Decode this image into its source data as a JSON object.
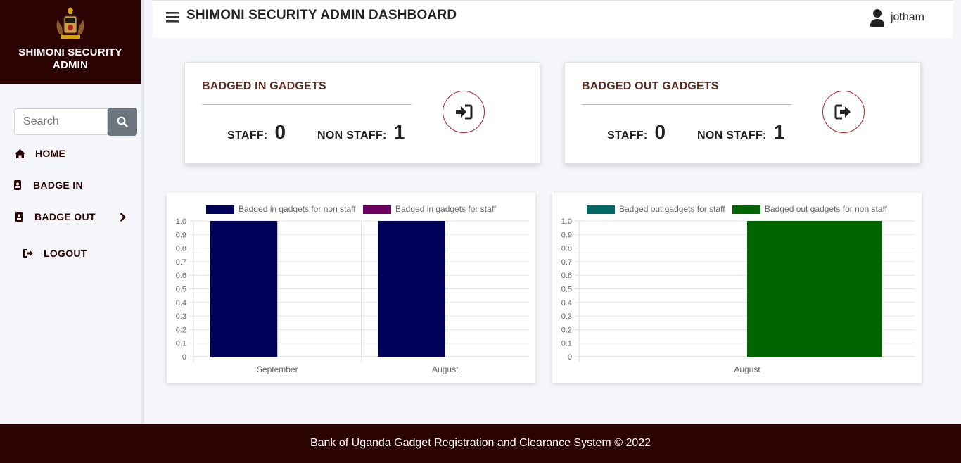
{
  "sidebar": {
    "brand_line1": "SHIMONI SECURITY",
    "brand_line2": "ADMIN",
    "search_placeholder": "Search",
    "items": [
      {
        "label": "HOME",
        "icon": "home-icon"
      },
      {
        "label": "BADGE IN",
        "icon": "id-badge-icon"
      },
      {
        "label": "BADGE OUT",
        "icon": "id-badge-icon"
      },
      {
        "label": "LOGOUT",
        "icon": "sign-out-icon"
      }
    ]
  },
  "header": {
    "title": "SHIMONI SECURITY ADMIN DASHBOARD",
    "username": "jotham"
  },
  "cards": [
    {
      "title": "BADGED IN GADGETS",
      "staff_label": "STAFF:",
      "staff_value": "0",
      "nonstaff_label": "NON STAFF:",
      "nonstaff_value": "1",
      "icon": "sign-in-icon"
    },
    {
      "title": "BADGED OUT GADGETS",
      "staff_label": "STAFF:",
      "staff_value": "0",
      "nonstaff_label": "NON STAFF:",
      "nonstaff_value": "1",
      "icon": "sign-out-icon"
    }
  ],
  "chart_data": [
    {
      "type": "bar",
      "categories": [
        "September",
        "August"
      ],
      "series": [
        {
          "name": "Badged in gadgets for non staff",
          "color": "#000059",
          "values": [
            1,
            1
          ]
        },
        {
          "name": "Badged in gadgets for staff",
          "color": "#6b0061",
          "values": [
            0,
            0
          ]
        }
      ],
      "ylim": [
        0,
        1
      ],
      "yticks": [
        "0",
        "0.1",
        "0.2",
        "0.3",
        "0.4",
        "0.5",
        "0.6",
        "0.7",
        "0.8",
        "0.9",
        "1.0"
      ],
      "grid": true,
      "legend": "top"
    },
    {
      "type": "bar",
      "categories": [
        "August"
      ],
      "series": [
        {
          "name": "Badged out gadgets for staff",
          "color": "#006666",
          "values": [
            0
          ]
        },
        {
          "name": "Badged out gadgets for non staff",
          "color": "#006400",
          "values": [
            1
          ]
        }
      ],
      "ylim": [
        0,
        1
      ],
      "yticks": [
        "0",
        "0.1",
        "0.2",
        "0.3",
        "0.4",
        "0.5",
        "0.6",
        "0.7",
        "0.8",
        "0.9",
        "1.0"
      ],
      "grid": true,
      "legend": "top"
    }
  ],
  "footer": {
    "text": "Bank of Uganda Gadget Registration and Clearance System © 2022"
  }
}
